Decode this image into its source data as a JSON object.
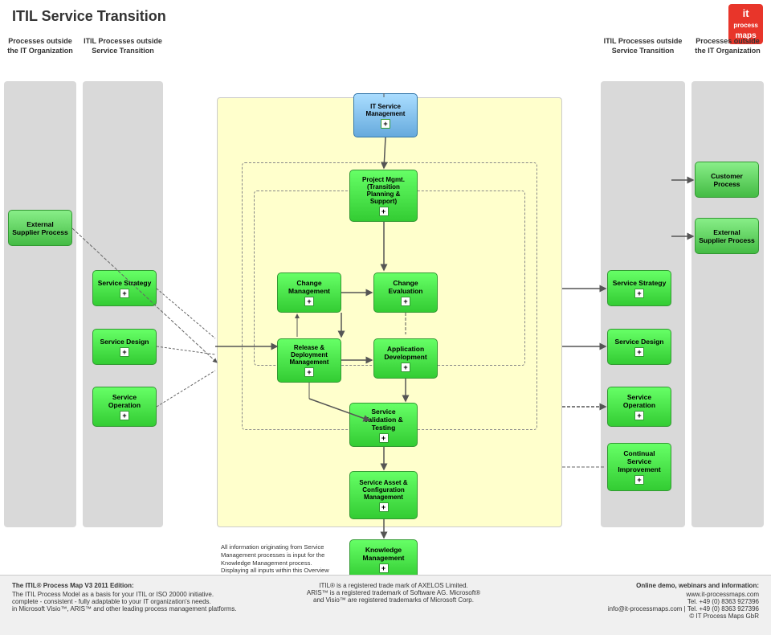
{
  "title": "ITIL Service Transition",
  "logo": {
    "it": "it",
    "process": "process",
    "maps": "maps"
  },
  "columns": {
    "left_outside": "Processes outside the IT Organization",
    "left_itil": "ITIL Processes outside Service Transition",
    "right_itil": "ITIL Processes outside Service Transition",
    "right_outside": "Processes outside the IT Organization"
  },
  "center_title": "IT Service Management",
  "processes": {
    "it_service_mgmt": "IT Service\nManagement",
    "project_mgmt": "Project Mgmt.\n(Transition\nPlanning &\nSupport)",
    "change_mgmt": "Change\nManagement",
    "change_eval": "Change\nEvaluation",
    "release_deploy": "Release &\nDeployment\nManagement",
    "app_dev": "Application\nDevelopment",
    "service_validation": "Service\nValidation &\nTesting",
    "service_asset": "Service Asset &\nConfiguration\nManagement",
    "knowledge": "Knowledge\nManagement",
    "ext_supplier_left": "External\nSupplier Process",
    "service_strategy_left": "Service Strategy",
    "service_design_left": "Service Design",
    "service_operation_left": "Service\nOperation",
    "customer_right": "Customer\nProcess",
    "ext_supplier_right": "External\nSupplier Process",
    "service_strategy_right": "Service Strategy",
    "service_design_right": "Service Design",
    "service_operation_right": "Service\nOperation",
    "continual_improvement": "Continual\nService\nImprovement"
  },
  "knowledge_note": "All information originating from Service Management processes is input for the Knowledge Management process. Displaying all inputs within this Overview Diagram is therefore not practicable.",
  "footer_left_title": "The ITIL® Process Map V3 2011 Edition:",
  "footer_left_lines": [
    "The ITIL Process Model as a basis for your ITIL or ISO 20000 initiative.",
    "complete - consistent - fully adaptable to your IT organization's needs.",
    "in Microsoft Visio™, ARIS™ and other leading process management platforms."
  ],
  "footer_right_title": "Online demo, webinars and information:",
  "footer_right_lines": [
    "www.it-processmaps.com",
    "Tel. +49 (0) 8363 927396",
    "info@it-processmaps.com | Tel. +49 (0) 8363 927396",
    "© IT Process Maps GbR"
  ],
  "footer_center_lines": [
    "ITIL® is a registered trade mark of AXELOS Limited.",
    "ARIS™ is a registered trademark of Software AG. Microsoft®",
    "and Visio™ are registered trademarks of Microsoft Corp."
  ]
}
